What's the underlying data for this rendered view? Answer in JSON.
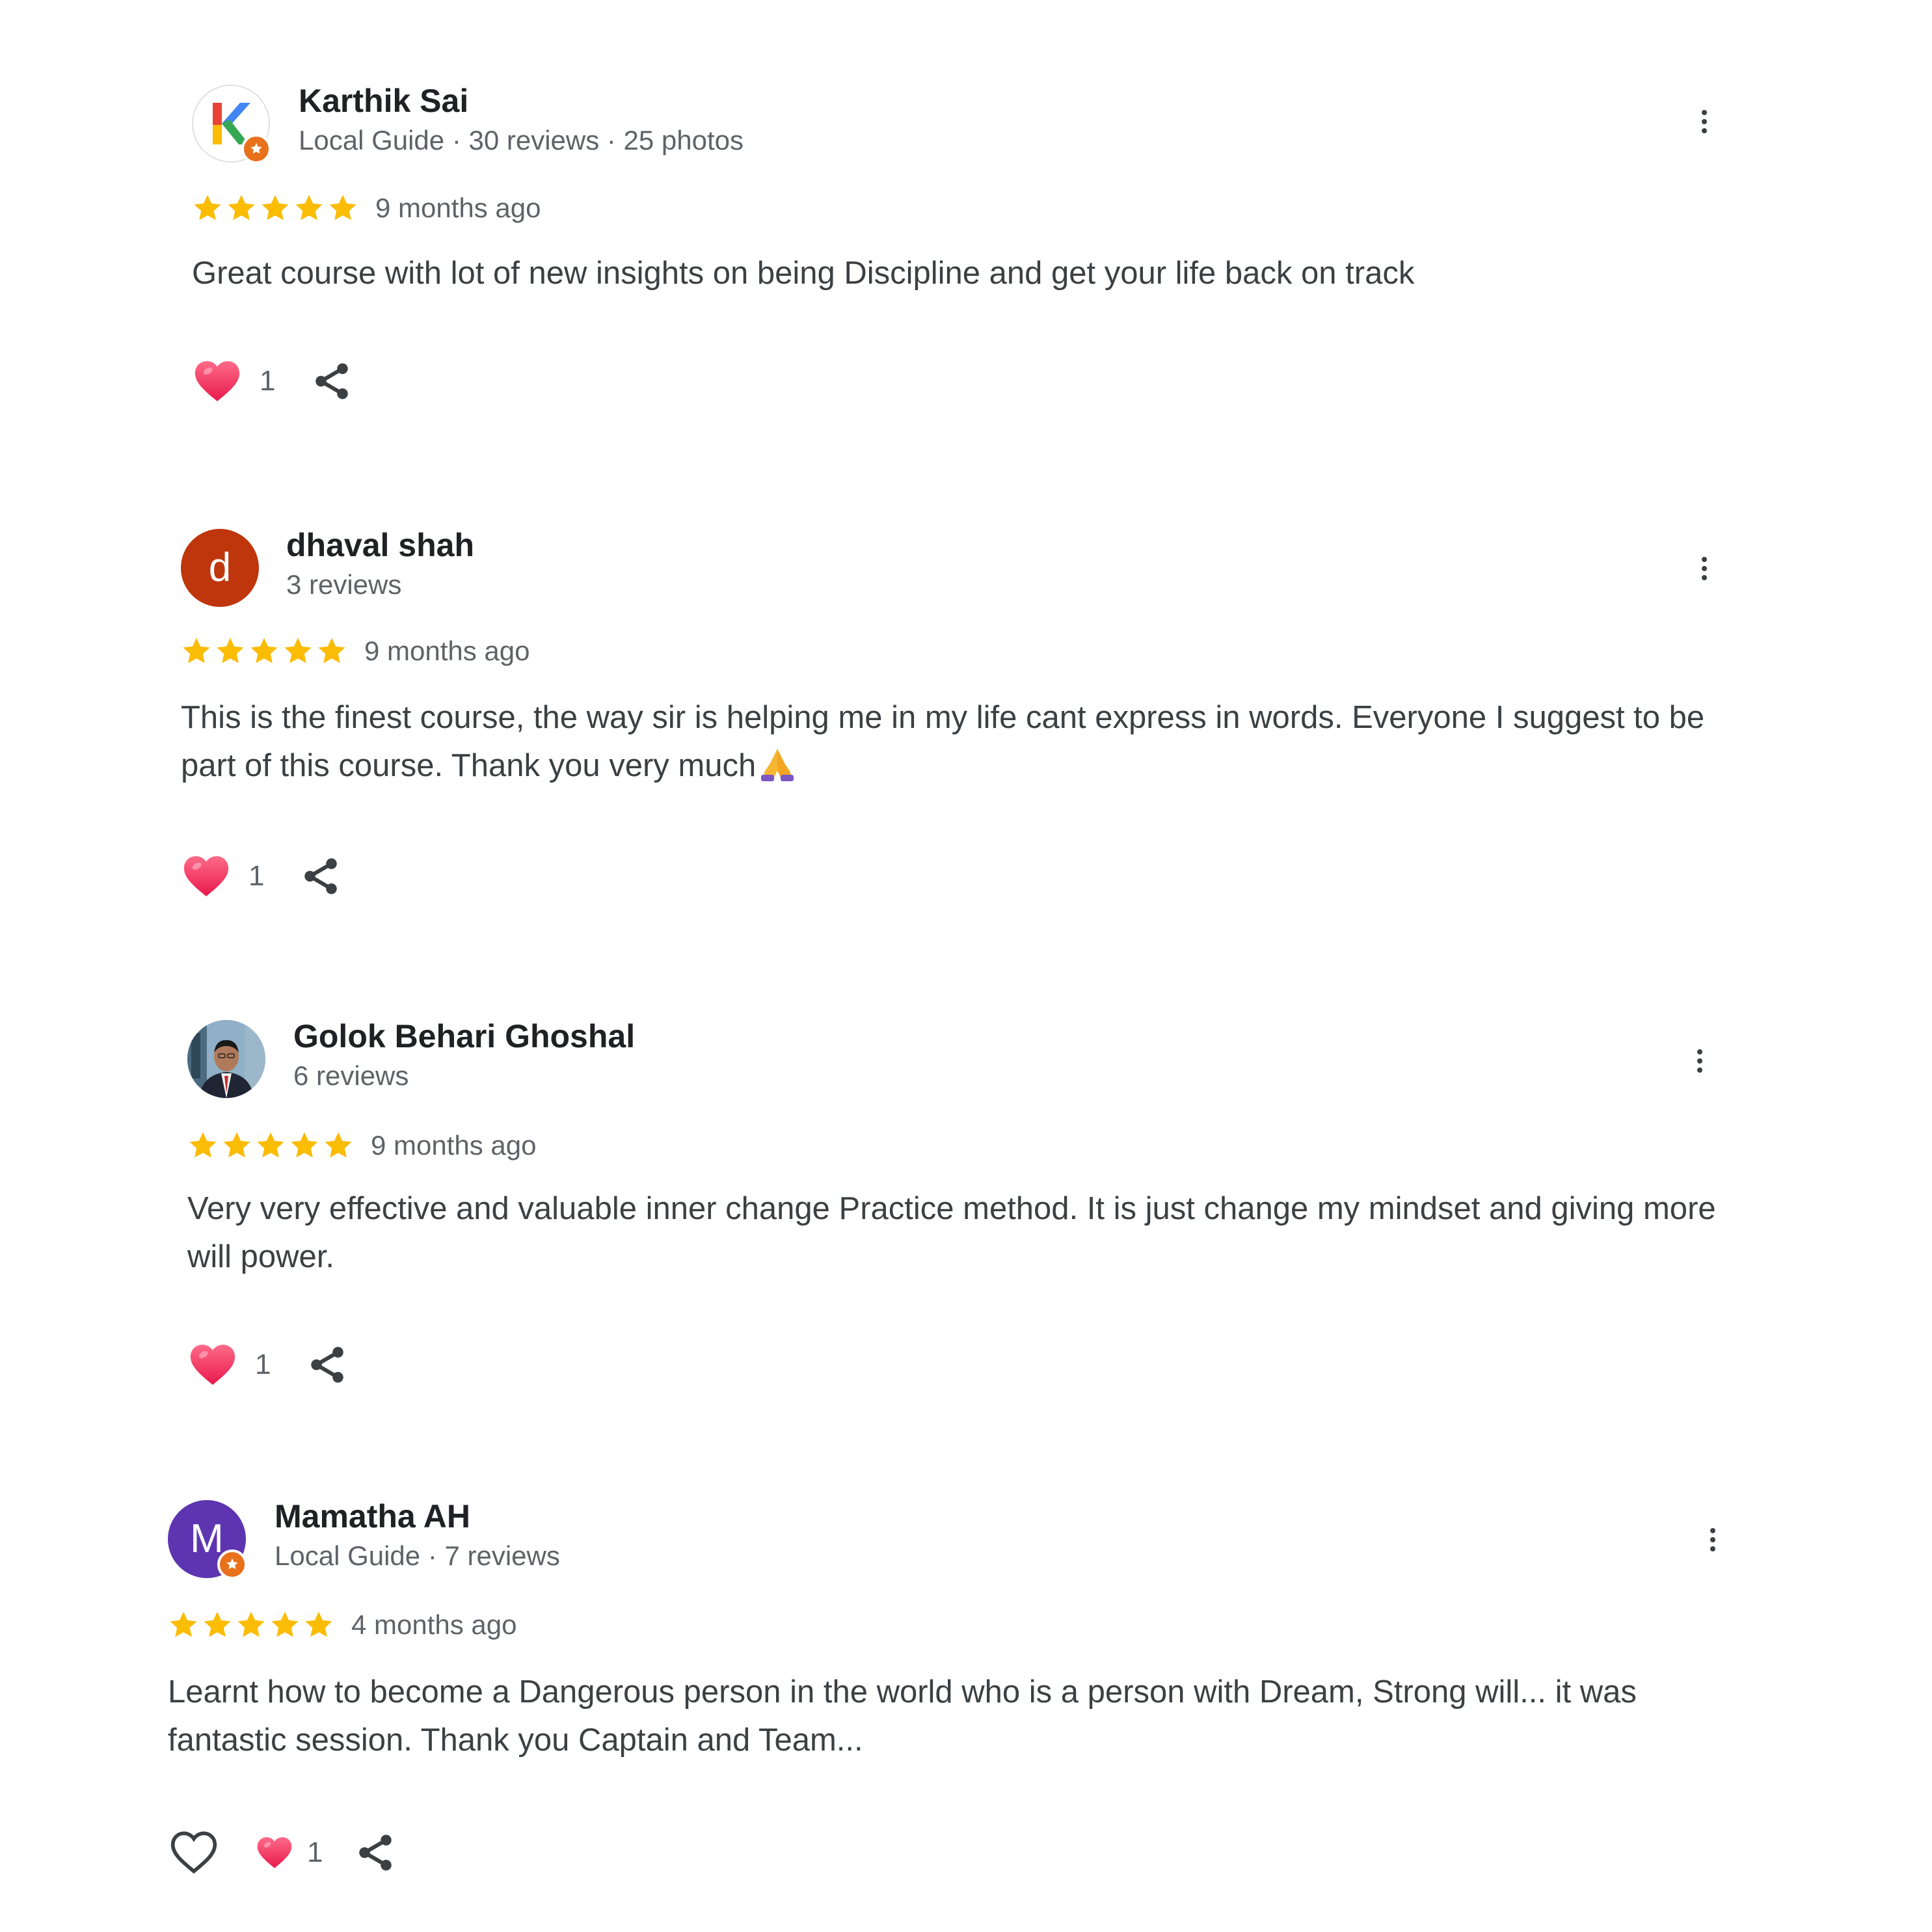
{
  "reviews": [
    {
      "author": "Karthik Sai",
      "meta": "Local Guide · 30 reviews · 25 photos",
      "avatar_type": "logo",
      "avatar_letter": "K",
      "local_guide": true,
      "rating": 5,
      "time": "9 months ago",
      "text": "Great course with lot of new insights on being Discipline and get your life back on track",
      "reaction_icon": "heart-icon",
      "reaction_count": "1"
    },
    {
      "author": "dhaval shah",
      "meta": "3 reviews",
      "avatar_type": "letter",
      "avatar_letter": "d",
      "avatar_color": "#bf360c",
      "local_guide": false,
      "rating": 5,
      "time": "9 months ago",
      "text": "This is the finest course, the way sir is helping me in my life cant express in words. Everyone I suggest to be part of this course. Thank you very much",
      "text_emoji": "folded-hands-emoji",
      "reaction_icon": "heart-icon",
      "reaction_count": "1"
    },
    {
      "author": "Golok Behari Ghoshal",
      "meta": "6 reviews",
      "avatar_type": "photo",
      "local_guide": false,
      "rating": 5,
      "time": "9 months ago",
      "text": "Very very effective and valuable inner change Practice method. It is just change my mindset and giving more will power.",
      "reaction_icon": "heart-icon",
      "reaction_count": "1"
    },
    {
      "author": "Mamatha AH",
      "meta": "Local Guide · 7 reviews",
      "avatar_type": "letter",
      "avatar_letter": "M",
      "avatar_color": "#5e35b1",
      "local_guide": true,
      "rating": 5,
      "time": "4 months ago",
      "text": "Learnt how to become a Dangerous person in the world who is a person with Dream, Strong will... it was fantastic session. Thank you Captain and Team...",
      "like_icon": "heart-outline-icon",
      "reaction_icon": "heart-icon",
      "reaction_count": "1"
    }
  ],
  "colors": {
    "star": "#fbbc04",
    "heart": "#f0426a",
    "badge": "#e8711c",
    "text": "#3c4043",
    "secondary": "#5f6368"
  }
}
